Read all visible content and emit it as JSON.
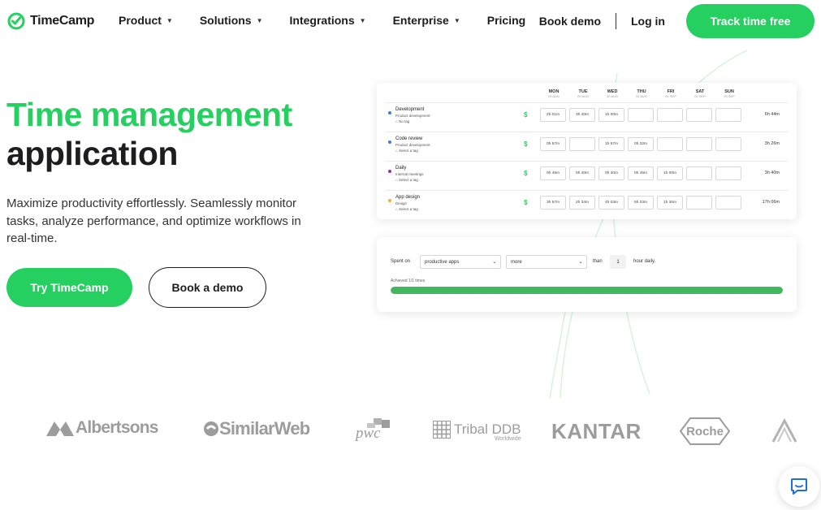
{
  "nav": {
    "logo_text": "TimeCamp",
    "menu": [
      {
        "label": "Product",
        "caret": "▼"
      },
      {
        "label": "Solutions",
        "caret": "▼"
      },
      {
        "label": "Integrations",
        "caret": "▼"
      },
      {
        "label": "Enterprise",
        "caret": "▼"
      },
      {
        "label": "Pricing",
        "caret": ""
      }
    ],
    "book_demo": "Book demo",
    "login": "Log in",
    "cta": "Track time free"
  },
  "hero": {
    "title_green": "Time management",
    "title_dark": "application",
    "description": "Maximize productivity effortlessly. Seamlessly monitor tasks, analyze performance, and optimize workflows in real-time.",
    "try_button": "Try TimeCamp",
    "demo_button": "Book a demo"
  },
  "timesheet": {
    "days": [
      {
        "name": "MON",
        "date": "26 AUG"
      },
      {
        "name": "TUE",
        "date": "29 AUG"
      },
      {
        "name": "WED",
        "date": "30 AUG"
      },
      {
        "name": "THU",
        "date": "31 AUG"
      },
      {
        "name": "FRI",
        "date": "01 SEP"
      },
      {
        "name": "SAT",
        "date": "02 SEP"
      },
      {
        "name": "SUN",
        "date": "03 SEP"
      }
    ],
    "rows": [
      {
        "name": "Development",
        "sub": "Product development",
        "tag": "No tag",
        "dot": "#3b7de0",
        "billable": "$",
        "cells": [
          "2h 01m",
          "3h 40m",
          "1h 00m",
          "",
          "",
          "",
          ""
        ],
        "total": "6h 44m"
      },
      {
        "name": "Code review",
        "sub": "Product development",
        "tag": "Select a tag",
        "dot": "#3b7de0",
        "billable": "$",
        "cells": [
          "0h 57m",
          "",
          "1h 57m",
          "0h 32m",
          "",
          "",
          ""
        ],
        "total": "3h 26m"
      },
      {
        "name": "Daily",
        "sub": "Internal meetings",
        "tag": "Select a tag",
        "dot": "#9b2bb0",
        "billable": "$",
        "cells": [
          "0h 45m",
          "0h 40m",
          "0h 30m",
          "0h 45m",
          "1h 00m",
          "",
          ""
        ],
        "total": "3h 40m"
      },
      {
        "name": "App design",
        "sub": "Design",
        "tag": "Select a tag",
        "dot": "#f2b233",
        "billable": "$",
        "cells": [
          "3h 57m",
          "2h 34m",
          "4h 03m",
          "5h 03m",
          "1h 30m",
          "",
          ""
        ],
        "total": "17h 06m"
      }
    ]
  },
  "goal": {
    "spent_on": "Spent on",
    "select1": "productive apps",
    "select2": "more",
    "than": "than",
    "hours": "1",
    "hour_daily": "hour daily.",
    "achieved": "Achieved 1/1 times",
    "progress": 1.0,
    "progress_color": "#43b661"
  },
  "logos": [
    {
      "name": "Albertsons"
    },
    {
      "name": "SimilarWeb"
    },
    {
      "name": "pwc"
    },
    {
      "name": "Tribal DDB",
      "sub": "Worldwide"
    },
    {
      "name": "KANTAR"
    },
    {
      "name": "Roche"
    }
  ],
  "colors": {
    "accent": "#25cf60",
    "text": "#1d1d1f",
    "logo_gray": "#9c9c9c"
  },
  "chat": {
    "icon": "chat-bubble-icon",
    "color": "#1d6fe0"
  }
}
